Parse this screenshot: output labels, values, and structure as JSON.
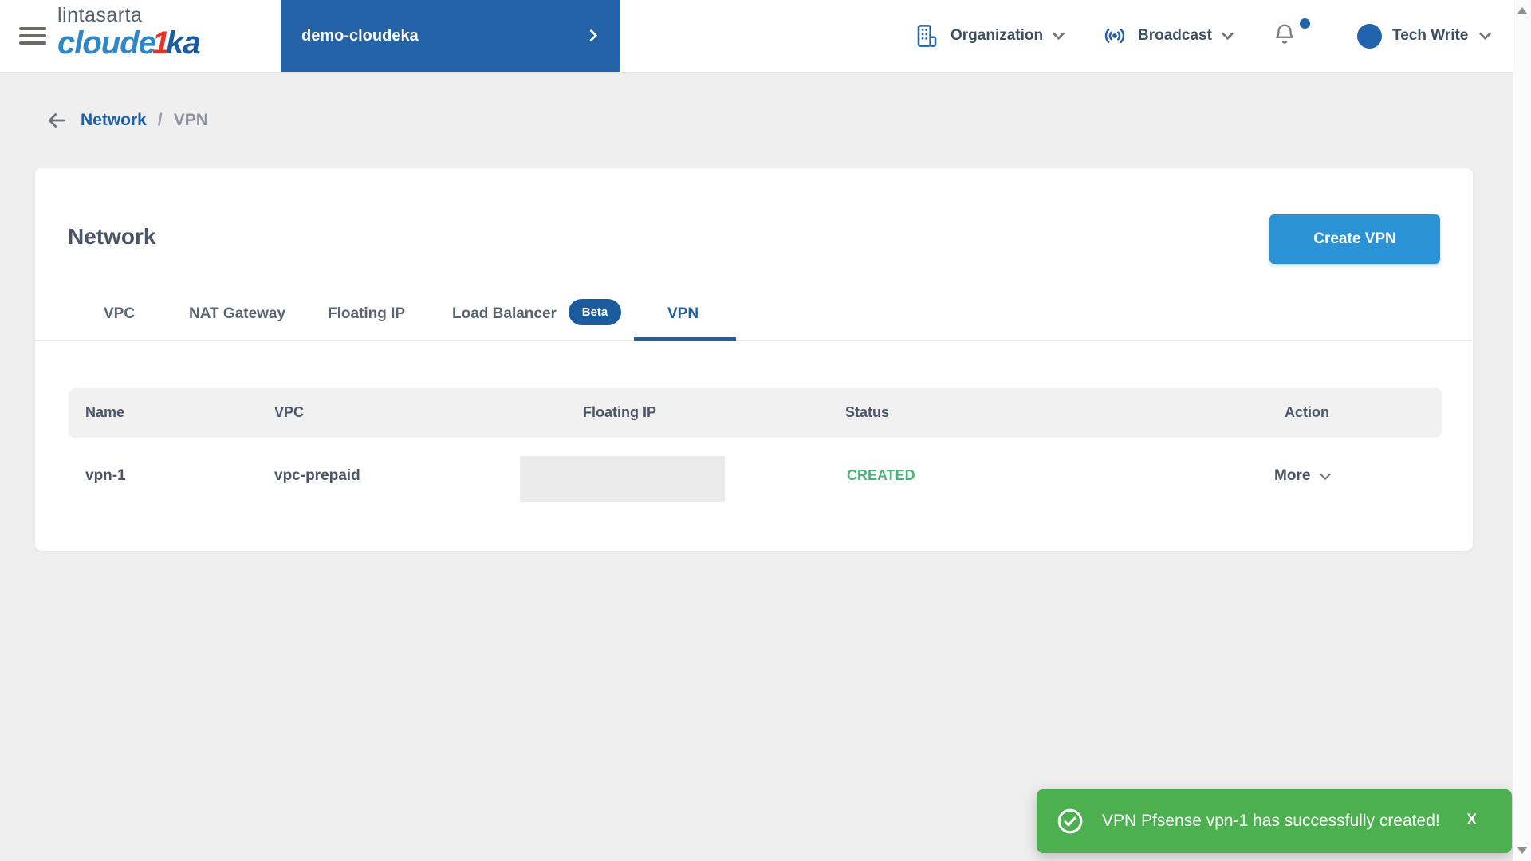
{
  "colors": {
    "brand_blue": "#2563a8",
    "button_blue": "#2a93d5",
    "active_tab_blue": "#1f5fa8",
    "status_green": "#4bb277",
    "toast_green": "#4caf50",
    "logo_red": "#e5332a"
  },
  "header": {
    "logo_line1": "lintasarta",
    "logo_pre": "cloude",
    "logo_accent": "1",
    "logo_post": "ka",
    "project": {
      "name": "demo-cloudeka"
    },
    "organization_label": "Organization",
    "broadcast_label": "Broadcast",
    "user_name": "Tech Write"
  },
  "breadcrumb": {
    "parent": "Network",
    "separator": "/",
    "current": "VPN"
  },
  "main": {
    "title": "Network",
    "create_button_label": "Create VPN",
    "tabs": [
      {
        "label": "VPC",
        "active": false
      },
      {
        "label": "NAT Gateway",
        "active": false
      },
      {
        "label": "Floating IP",
        "active": false
      },
      {
        "label": "Load Balancer",
        "badge": "Beta",
        "active": false
      },
      {
        "label": "VPN",
        "active": true
      }
    ]
  },
  "table": {
    "columns": [
      "Name",
      "VPC",
      "Floating IP",
      "Status",
      "Action"
    ],
    "rows": [
      {
        "name": "vpn-1",
        "vpc": "vpc-prepaid",
        "floating_ip": "",
        "status": "CREATED",
        "action": "More"
      }
    ]
  },
  "toast": {
    "message": "VPN Pfsense vpn-1 has successfully created!",
    "close_label": "X"
  }
}
